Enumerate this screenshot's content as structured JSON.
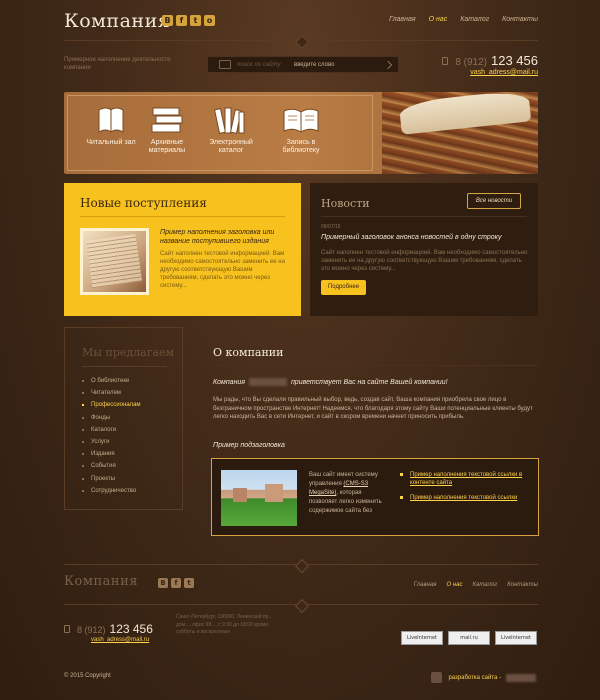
{
  "header": {
    "logo": "Компания",
    "socials": [
      "В",
      "f",
      "t",
      "о"
    ],
    "nav": [
      {
        "label": "Главная",
        "active": false
      },
      {
        "label": "О нас",
        "active": true
      },
      {
        "label": "Каталог",
        "active": false
      },
      {
        "label": "Контакты",
        "active": false
      }
    ],
    "tagline": "Примерное наполнение деятельности компании",
    "search": {
      "label": "поиск по сайту:",
      "value": "введите слово"
    },
    "phone": {
      "code": "8 (912)",
      "number": "123 456",
      "email": "vash_adress@mail.ru"
    }
  },
  "banner": {
    "categories": [
      {
        "label": "Читальный зал",
        "icon": "open-book-icon"
      },
      {
        "label": "Архивные материалы",
        "icon": "books-stack-icon"
      },
      {
        "label": "Электронный каталог",
        "icon": "books-rack-icon"
      },
      {
        "label": "Запись в библиотеку",
        "icon": "book-write-icon"
      }
    ]
  },
  "new_arrivals": {
    "title": "Новые поступления",
    "heading": "Пример наполнения заголовка или название поступившего издания",
    "text": "Сайт наполнен тестовой информацией. Вам необходимо самостоятельно заменить ее на другую соответствующую Вашим требованиям, сделать это можно через систему..."
  },
  "news": {
    "title": "Новости",
    "all_button": "Все новости",
    "date": "09/07/15",
    "heading": "Примерный заголовок анонса новостей в одну строку",
    "text": "Сайт наполнен тестовой информацией. Вам необходимо самостоятельно заменить ее на другую соответствующую Вашим требованиям, сделать это можно через систему...",
    "more_button": "Подробнее"
  },
  "sidebar": {
    "title": "Мы предлагаем",
    "items": [
      {
        "label": "О библиотеке",
        "active": false
      },
      {
        "label": "Читателям",
        "active": false
      },
      {
        "label": "Профессионалам",
        "active": true
      },
      {
        "label": "Фонды",
        "active": false
      },
      {
        "label": "Каталоги",
        "active": false
      },
      {
        "label": "Услуги",
        "active": false
      },
      {
        "label": "Издания",
        "active": false
      },
      {
        "label": "События",
        "active": false
      },
      {
        "label": "Проекты",
        "active": false
      },
      {
        "label": "Сотрудничество",
        "active": false
      }
    ]
  },
  "about": {
    "title": "О компании",
    "welcome_before": "Компания",
    "welcome_after": "приветствует Вас на сайте Вашей компании!",
    "text": "Мы рады, что Вы сделали правильный выбор, ведь, создав сайт, Ваша компания приобрела свое лицо в безграничном пространстве Интернет! Надеемся, что благодаря этому сайту Ваши потенциальные клиенты будут легко находить Вас в сети Интернет, и сайт в скором времени начнет приносить прибыль.",
    "subtitle": "Пример подзаголовка",
    "example_text_1": "Ваш сайт имеет систему управления ",
    "example_link": "(CMS-S3 MegaSite)",
    "example_text_2": ", которая позволяет легко изменить содержимое сайта без",
    "links": [
      "Пример наполнения текстовой ссылки в контенте сайта",
      "Пример наполнения текстовой ссылки"
    ]
  },
  "footer": {
    "logo": "Компания",
    "socials": [
      "В",
      "f",
      "t"
    ],
    "nav": [
      {
        "label": "Главная",
        "active": false
      },
      {
        "label": "О нас",
        "active": true
      },
      {
        "label": "Каталог",
        "active": false
      },
      {
        "label": "Контакты",
        "active": false
      }
    ],
    "phone_code": "8 (912)",
    "phone_number": "123 456",
    "email": "vash_adress@mail.ru",
    "address": "Санкт-Петербург, 190000, Ленинский пр., дом..., офис 98..., с 9:30 до 18:00 кроме субботы и воскресенья",
    "counters": [
      "LiveInternet",
      "mail.ru",
      "LiveInternet"
    ],
    "copyright": "© 2015 Copyright",
    "developer": "разработка сайта -"
  },
  "colors": {
    "accent": "#f7c21e",
    "background": "#3d2617",
    "panel_dark": "#2f1d10",
    "link": "#ffd24a"
  }
}
